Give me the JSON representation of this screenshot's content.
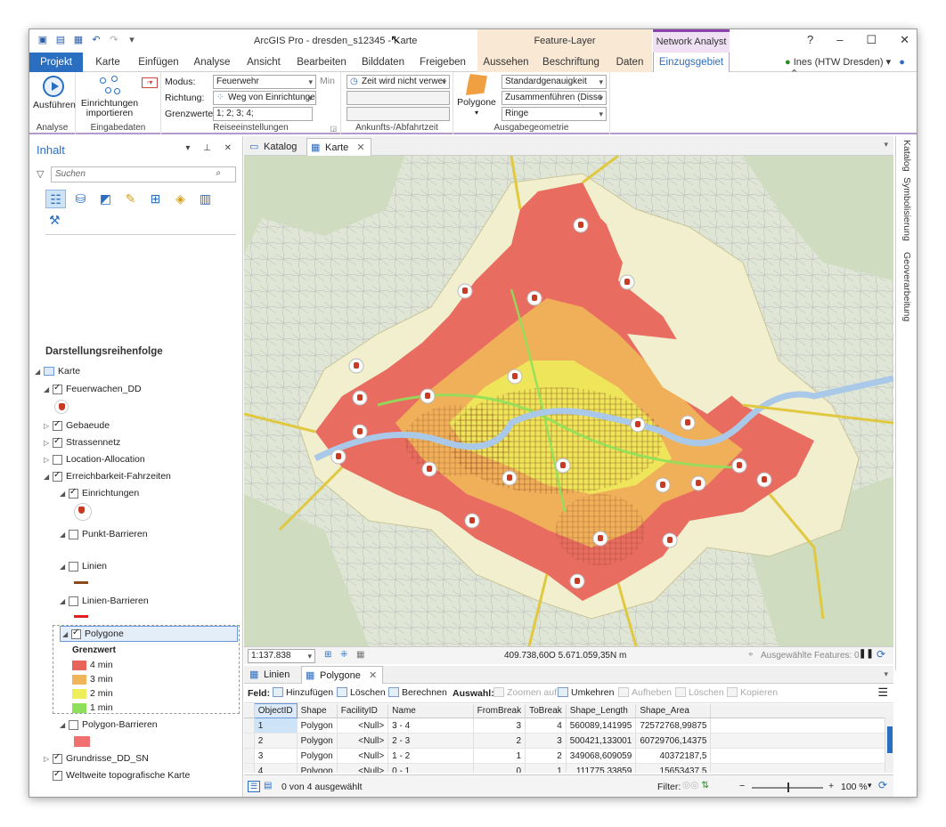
{
  "window": {
    "title": "ArcGIS Pro - dresden_s12345 - Karte",
    "context_feature_layer": "Feature-Layer",
    "context_network_analyst": "Network Analyst",
    "help": "?",
    "minimize": "–",
    "maximize": "☐",
    "close": "✕"
  },
  "tabs": [
    "Projekt",
    "Karte",
    "Einfügen",
    "Analyse",
    "Ansicht",
    "Bearbeiten",
    "Bilddaten",
    "Freigeben",
    "Aussehen",
    "Beschriftung",
    "Daten",
    "Einzugsgebiet"
  ],
  "user": "Ines (HTW Dresden)",
  "ribbon": {
    "analyse": {
      "button": "Ausführen",
      "group": "Analyse"
    },
    "eingabedaten": {
      "button": "Einrichtungen importieren",
      "button_l1": "Einrichtungen",
      "button_l2": "importieren",
      "group": "Eingabedaten"
    },
    "reise": {
      "modus_label": "Modus:",
      "modus_value": "Feuerwehr",
      "unit": "Min",
      "richtung_label": "Richtung:",
      "richtung_value": "Weg von Einrichtunge",
      "grenz_label": "Grenzwerte:",
      "grenz_value": "1; 2; 3; 4;",
      "group": "Reiseeinstellungen"
    },
    "ankunft": {
      "value": "Zeit wird nicht verwer",
      "group": "Ankunfts-/Abfahrtzeit"
    },
    "ausgabe": {
      "button": "Polygone",
      "genauigkeit": "Standardgenauigkeit",
      "zusammen": "Zusammenführen (Dissc",
      "ringe": "Ringe",
      "group": "Ausgabegeometrie"
    }
  },
  "contents": {
    "title": "Inhalt",
    "search_placeholder": "Suchen",
    "section": "Darstellungsreihenfolge",
    "map": "Karte",
    "layers": {
      "feuerwachen": "Feuerwachen_DD",
      "gebaeude": "Gebaeude",
      "strassennetz": "Strassennetz",
      "location": "Location-Allocation",
      "erreichbarkeit": "Erreichbarkeit-Fahrzeiten",
      "einrichtungen": "Einrichtungen",
      "punkt": "Punkt-Barrieren",
      "linien": "Linien",
      "linienbarrieren": "Linien-Barrieren",
      "polygone": "Polygone",
      "grenzwert": "Grenzwert",
      "polygonbarrieren": "Polygon-Barrieren",
      "grundrisse": "Grundrisse_DD_SN",
      "topo": "Weltweite topografische Karte"
    },
    "legend": [
      {
        "label": "4 min",
        "color": "#e8645a"
      },
      {
        "label": "3 min",
        "color": "#f0b45a"
      },
      {
        "label": "2 min",
        "color": "#eeee5a"
      },
      {
        "label": "1 min",
        "color": "#8ee05a"
      }
    ]
  },
  "doc_tabs": {
    "katalog": "Katalog",
    "karte": "Karte"
  },
  "side_tabs": [
    "Katalog",
    "Symbolisierung",
    "Geoverarbeitung"
  ],
  "map_status": {
    "scale": "1:137.838",
    "coords": "409.738,60O 5.671.059,35N m",
    "selected": "Ausgewählte Features: 0"
  },
  "table": {
    "tabs": {
      "linien": "Linien",
      "polygone": "Polygone"
    },
    "toolbar": {
      "feld": "Feld:",
      "hinzufuegen": "Hinzufügen",
      "loeschen": "Löschen",
      "berechnen": "Berechnen",
      "auswahl": "Auswahl:",
      "zoomen": "Zoomen auf",
      "umkehren": "Umkehren",
      "aufheben": "Aufheben",
      "loeschen2": "Löschen",
      "kopieren": "Kopieren"
    },
    "columns": [
      "ObjectID",
      "Shape",
      "FacilityID",
      "Name",
      "FromBreak",
      "ToBreak",
      "Shape_Length",
      "Shape_Area"
    ],
    "rows": [
      [
        "1",
        "Polygon",
        "<Null>",
        "3 - 4",
        "3",
        "4",
        "560089,141995",
        "72572768,99875"
      ],
      [
        "2",
        "Polygon",
        "<Null>",
        "2 - 3",
        "2",
        "3",
        "500421,133001",
        "60729706,14375"
      ],
      [
        "3",
        "Polygon",
        "<Null>",
        "1 - 2",
        "1",
        "2",
        "349068,609059",
        "40372187,5"
      ],
      [
        "4",
        "Polygon",
        "<Null>",
        "0 - 1",
        "0",
        "1",
        "111775,33859",
        "15653437,5"
      ]
    ],
    "status": "0 von 4 ausgewählt",
    "filter": "Filter:",
    "zoom": "100 %"
  }
}
